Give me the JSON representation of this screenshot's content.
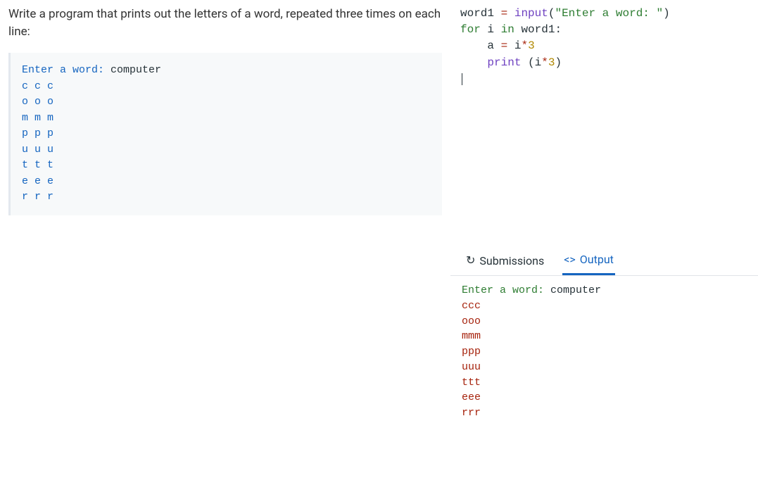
{
  "problem": {
    "text": "Write a program that prints out the letters of a word, repeated three times on each line:"
  },
  "example": {
    "prompt": "Enter a word:",
    "input": "computer",
    "lines": [
      "c c c",
      "o o o",
      "m m m",
      "p p p",
      "u u u",
      "t t t",
      "e e e",
      "r r r"
    ]
  },
  "code": {
    "lines": [
      {
        "tokens": [
          [
            "var",
            "word1"
          ],
          [
            "plain",
            " "
          ],
          [
            "op",
            "="
          ],
          [
            "plain",
            " "
          ],
          [
            "fn",
            "input"
          ],
          [
            "plain",
            "("
          ],
          [
            "str",
            "\"Enter a word: \""
          ],
          [
            "plain",
            ")"
          ]
        ]
      },
      {
        "tokens": [
          [
            "kw",
            "for"
          ],
          [
            "plain",
            " "
          ],
          [
            "var",
            "i"
          ],
          [
            "plain",
            " "
          ],
          [
            "kw",
            "in"
          ],
          [
            "plain",
            " "
          ],
          [
            "var",
            "word1"
          ],
          [
            "plain",
            ":"
          ]
        ]
      },
      {
        "tokens": [
          [
            "plain",
            "    "
          ],
          [
            "var",
            "a"
          ],
          [
            "plain",
            " "
          ],
          [
            "op",
            "="
          ],
          [
            "plain",
            " "
          ],
          [
            "var",
            "i"
          ],
          [
            "op",
            "*"
          ],
          [
            "num",
            "3"
          ]
        ]
      },
      {
        "tokens": [
          [
            "plain",
            "    "
          ],
          [
            "fn",
            "print"
          ],
          [
            "plain",
            " ("
          ],
          [
            "var",
            "i"
          ],
          [
            "op",
            "*"
          ],
          [
            "num",
            "3"
          ],
          [
            "plain",
            ")"
          ]
        ]
      }
    ]
  },
  "tabs": {
    "submissions": {
      "label": "Submissions",
      "icon": "↻"
    },
    "output": {
      "label": "Output",
      "icon": "<>"
    }
  },
  "output": {
    "prompt": "Enter a word:",
    "input": "computer",
    "lines": [
      "ccc",
      "ooo",
      "mmm",
      "ppp",
      "uuu",
      "ttt",
      "eee",
      "rrr"
    ]
  }
}
